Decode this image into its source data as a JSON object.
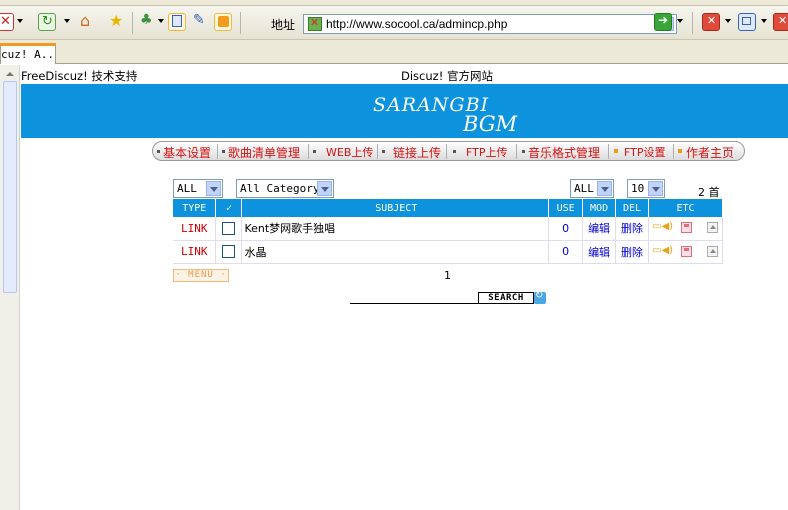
{
  "browser": {
    "address_label": "地址",
    "url": "http://www.socool.ca/admincp.php",
    "tab_title": "cuz! A..."
  },
  "page": {
    "top_left_link": "FreeDiscuz! 技术支持",
    "top_center_link": "Discuz! 官方网站",
    "logo_line1": "SARANGBI",
    "logo_line2": "BGM"
  },
  "nav": {
    "items": [
      "基本设置",
      "歌曲清单管理",
      "WEB上传",
      "链接上传",
      "FTP上传",
      "音乐格式管理",
      "FTP设置",
      "作者主页"
    ]
  },
  "filters": {
    "left_select": "ALL",
    "category_select": "All Category",
    "right_select": "ALL",
    "per_page_select": "10",
    "page_count": "2 首"
  },
  "table": {
    "headers": [
      "TYPE",
      "✓",
      "SUBJECT",
      "USE",
      "MOD",
      "DEL",
      "ETC"
    ],
    "rows": [
      {
        "type": "LINK",
        "subject": "Kent梦网歌手独唱",
        "use": "0",
        "mod": "编辑",
        "del": "删除"
      },
      {
        "type": "LINK",
        "subject": "水晶",
        "use": "0",
        "mod": "编辑",
        "del": "删除"
      }
    ]
  },
  "footer": {
    "menu_label": "· MENU ·",
    "page_number": "1",
    "search_label": "SEARCH"
  },
  "colors": {
    "banner": "#0d92de",
    "nav_text": "#dd1111",
    "link_blue": "#0000cc"
  }
}
